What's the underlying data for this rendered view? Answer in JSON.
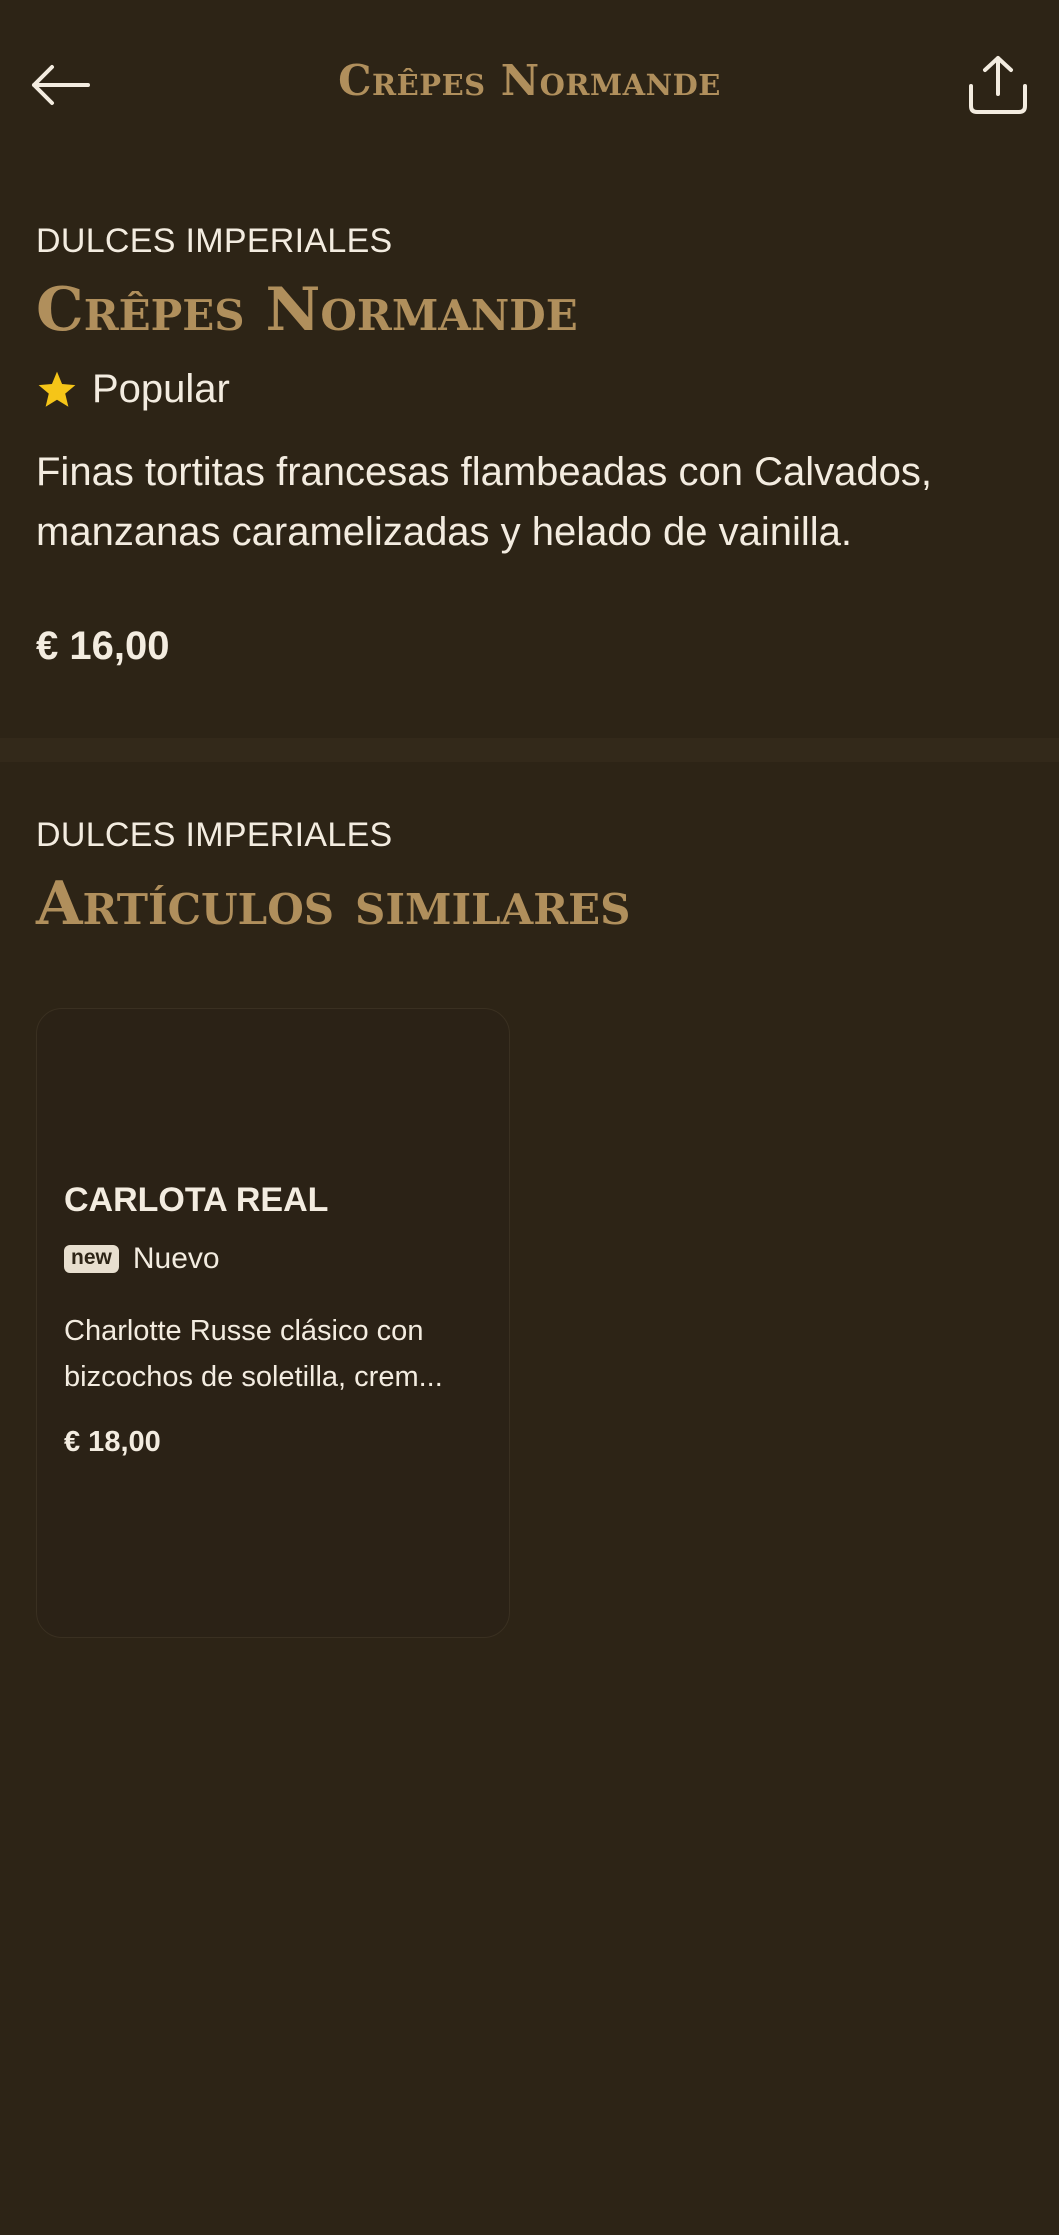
{
  "header": {
    "title": "Crêpes Normande",
    "back_icon": "arrow-left-icon",
    "share_icon": "share-upload-icon"
  },
  "item": {
    "category": "DULCES IMPERIALES",
    "title": "Crêpes Normande",
    "badge_icon": "star-icon",
    "badge_label": "Popular",
    "description": "Finas tortitas francesas flambeadas con Calvados, manzanas caramelizadas y helado de vainilla.",
    "price": "€ 16,00"
  },
  "similar": {
    "category": "DULCES IMPERIALES",
    "title": "Artículos similares",
    "cards": [
      {
        "title": "CARLOTA REAL",
        "badge_tag": "new",
        "badge_label": "Nuevo",
        "description_line1": "Charlotte Russe clásico con",
        "description_line2": "bizcochos de soletilla, crem...",
        "price": "€ 18,00"
      }
    ]
  },
  "colors": {
    "background": "#2d2416",
    "accent_gold": "#b08f5c",
    "text": "#f3ece0",
    "star": "#f5c518"
  }
}
